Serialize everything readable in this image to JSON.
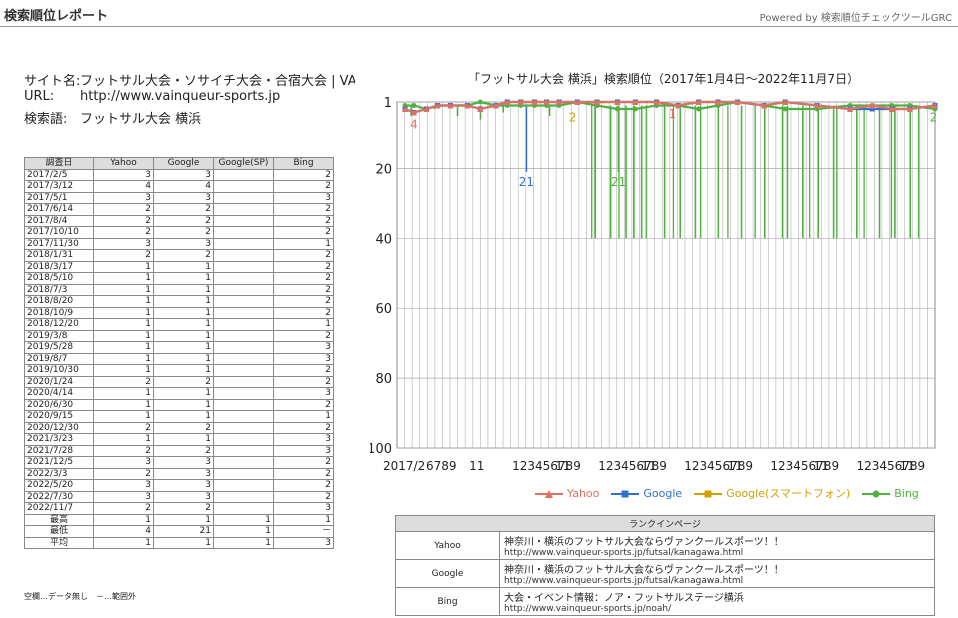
{
  "header": {
    "title": "検索順位レポート",
    "powered": "Powered by 検索順位チェックツールGRC"
  },
  "meta": {
    "site_label": "サイト名:",
    "site_value": "フットサル大会・ソサイチ大会・合宿大会 | VAINQUEUR",
    "url_label": "URL:",
    "url_value": "http://www.vainqueur-sports.jp",
    "keyword_label": "検索語:",
    "keyword_value": "フットサル大会 横浜"
  },
  "table": {
    "headers": [
      "調査日",
      "Yahoo",
      "Google",
      "Google(SP)",
      "Bing"
    ],
    "rows": [
      [
        "2017/2/5",
        "3",
        "3",
        "",
        "2"
      ],
      [
        "2017/3/12",
        "4",
        "4",
        "",
        "2"
      ],
      [
        "2017/5/1",
        "3",
        "3",
        "",
        "3"
      ],
      [
        "2017/6/14",
        "2",
        "2",
        "",
        "2"
      ],
      [
        "2017/8/4",
        "2",
        "2",
        "",
        "2"
      ],
      [
        "2017/10/10",
        "2",
        "2",
        "",
        "2"
      ],
      [
        "2017/11/30",
        "3",
        "3",
        "",
        "1"
      ],
      [
        "2018/1/31",
        "2",
        "2",
        "",
        "2"
      ],
      [
        "2018/3/17",
        "1",
        "1",
        "",
        "2"
      ],
      [
        "2018/5/10",
        "1",
        "1",
        "",
        "2"
      ],
      [
        "2018/7/3",
        "1",
        "1",
        "",
        "2"
      ],
      [
        "2018/8/20",
        "1",
        "1",
        "",
        "2"
      ],
      [
        "2018/10/9",
        "1",
        "1",
        "",
        "2"
      ],
      [
        "2018/12/20",
        "1",
        "1",
        "",
        "1"
      ],
      [
        "2019/3/8",
        "1",
        "1",
        "",
        "2"
      ],
      [
        "2019/5/28",
        "1",
        "1",
        "",
        "3"
      ],
      [
        "2019/8/7",
        "1",
        "1",
        "",
        "3"
      ],
      [
        "2019/10/30",
        "1",
        "1",
        "",
        "2"
      ],
      [
        "2020/1/24",
        "2",
        "2",
        "",
        "2"
      ],
      [
        "2020/4/14",
        "1",
        "1",
        "",
        "3"
      ],
      [
        "2020/6/30",
        "1",
        "1",
        "",
        "2"
      ],
      [
        "2020/9/15",
        "1",
        "1",
        "",
        "1"
      ],
      [
        "2020/12/30",
        "2",
        "2",
        "",
        "2"
      ],
      [
        "2021/3/23",
        "1",
        "1",
        "",
        "3"
      ],
      [
        "2021/7/28",
        "2",
        "2",
        "",
        "3"
      ],
      [
        "2021/12/5",
        "3",
        "3",
        "",
        "2"
      ],
      [
        "2022/3/3",
        "2",
        "3",
        "",
        "2"
      ],
      [
        "2022/5/20",
        "3",
        "3",
        "",
        "2"
      ],
      [
        "2022/7/30",
        "3",
        "3",
        "",
        "2"
      ],
      [
        "2022/11/7",
        "2",
        "2",
        "",
        "3"
      ]
    ],
    "stats": [
      [
        "最高",
        "1",
        "1",
        "1",
        "1"
      ],
      [
        "最低",
        "4",
        "21",
        "1",
        "－"
      ],
      [
        "平均",
        "1",
        "1",
        "1",
        "3"
      ]
    ]
  },
  "note": "空欄…データ無し　－…範囲外",
  "chart_data": {
    "type": "line",
    "title": "「フットサル大会 横浜」検索順位（2017年1月4日～2022年11月7日）",
    "y_inverted": true,
    "ylim": [
      1,
      100
    ],
    "y_ticks": [
      "1",
      "20",
      "40",
      "60",
      "80",
      "100"
    ],
    "x_tick_labels": [
      "2017/2",
      "6789",
      "11",
      "123456789",
      "11",
      "123456789",
      "11",
      "123456789",
      "11",
      "123456789",
      "11",
      "123456789",
      "11"
    ],
    "x_range": [
      "2017-01-04",
      "2022-11-07"
    ],
    "grid": true,
    "legend_position": "bottom",
    "series": [
      {
        "name": "Yahoo",
        "color": "#e07060",
        "marker": "triangle",
        "annotations": [
          {
            "label": "4",
            "date": "2017-03-12"
          },
          {
            "label": "1",
            "date": "2020-01-01"
          }
        ]
      },
      {
        "name": "Google",
        "color": "#3070d0",
        "marker": "square",
        "annotations": [
          {
            "label": "21",
            "date": "2018-06-01"
          }
        ]
      },
      {
        "name": "Google(スマートフォン)",
        "color": "#d0a000",
        "marker": "square",
        "annotations": [
          {
            "label": "2",
            "date": "2018-12-01"
          }
        ]
      },
      {
        "name": "Bing",
        "color": "#50b040",
        "marker": "circle",
        "annotations": [
          {
            "label": "21",
            "date": "2019-06-01"
          },
          {
            "label": "2",
            "date": "2022-11-01"
          }
        ]
      }
    ],
    "sampled_points": [
      {
        "date": "2017-02-05",
        "Yahoo": 3,
        "Google": 3,
        "Bing": 2
      },
      {
        "date": "2017-03-12",
        "Yahoo": 4,
        "Google": 4,
        "Bing": 2
      },
      {
        "date": "2017-05-01",
        "Yahoo": 3,
        "Google": 3,
        "Bing": 3
      },
      {
        "date": "2017-06-14",
        "Yahoo": 2,
        "Google": 2,
        "Bing": 2
      },
      {
        "date": "2017-08-04",
        "Yahoo": 2,
        "Google": 2,
        "Bing": 2
      },
      {
        "date": "2017-10-10",
        "Yahoo": 2,
        "Google": 2,
        "Bing": 2
      },
      {
        "date": "2017-11-30",
        "Yahoo": 3,
        "Google": 3,
        "Bing": 1
      },
      {
        "date": "2018-01-31",
        "Yahoo": 2,
        "Google": 2,
        "Bing": 2
      },
      {
        "date": "2018-03-17",
        "Yahoo": 1,
        "Google": 1,
        "Bing": 2
      },
      {
        "date": "2018-05-10",
        "Yahoo": 1,
        "Google": 1,
        "Bing": 2
      },
      {
        "date": "2018-07-03",
        "Yahoo": 1,
        "Google": 1,
        "Bing": 2
      },
      {
        "date": "2018-08-20",
        "Yahoo": 1,
        "Google": 1,
        "Bing": 2
      },
      {
        "date": "2018-10-09",
        "Yahoo": 1,
        "Google": 1,
        "Bing": 2
      },
      {
        "date": "2018-12-20",
        "Yahoo": 1,
        "Google": 1,
        "Bing": 1
      },
      {
        "date": "2019-03-08",
        "Yahoo": 1,
        "Google": 1,
        "Bing": 2
      },
      {
        "date": "2019-05-28",
        "Yahoo": 1,
        "Google": 1,
        "Bing": 3
      },
      {
        "date": "2019-08-07",
        "Yahoo": 1,
        "Google": 1,
        "Bing": 3
      },
      {
        "date": "2019-10-30",
        "Yahoo": 1,
        "Google": 1,
        "Bing": 2
      },
      {
        "date": "2020-01-24",
        "Yahoo": 2,
        "Google": 2,
        "Bing": 2
      },
      {
        "date": "2020-04-14",
        "Yahoo": 1,
        "Google": 1,
        "Bing": 3
      },
      {
        "date": "2020-06-30",
        "Yahoo": 1,
        "Google": 1,
        "Bing": 2
      },
      {
        "date": "2020-09-15",
        "Yahoo": 1,
        "Google": 1,
        "Bing": 1
      },
      {
        "date": "2020-12-30",
        "Yahoo": 2,
        "Google": 2,
        "Bing": 2
      },
      {
        "date": "2021-03-23",
        "Yahoo": 1,
        "Google": 1,
        "Bing": 3
      },
      {
        "date": "2021-07-28",
        "Yahoo": 2,
        "Google": 2,
        "Bing": 3
      },
      {
        "date": "2021-12-05",
        "Yahoo": 3,
        "Google": 3,
        "Bing": 2
      },
      {
        "date": "2022-03-03",
        "Yahoo": 2,
        "Google": 3,
        "Bing": 2
      },
      {
        "date": "2022-05-20",
        "Yahoo": 3,
        "Google": 3,
        "Bing": 2
      },
      {
        "date": "2022-07-30",
        "Yahoo": 3,
        "Google": 3,
        "Bing": 2
      },
      {
        "date": "2022-11-07",
        "Yahoo": 2,
        "Google": 2,
        "Bing": 3
      }
    ],
    "spikes": [
      {
        "series": "Google",
        "date": "2018-06-01",
        "value": 21
      },
      {
        "series": "Bing",
        "date": "2017-03-01",
        "value": 5
      },
      {
        "series": "Bing",
        "date": "2017-06-01",
        "value": 3
      },
      {
        "series": "Bing",
        "date": "2017-09-01",
        "value": 5
      },
      {
        "series": "Bing",
        "date": "2017-12-01",
        "value": 6
      },
      {
        "series": "Bing",
        "date": "2018-03-01",
        "value": 4
      },
      {
        "series": "Bing",
        "date": "2018-09-01",
        "value": 5
      },
      {
        "series": "Bing",
        "date": "2019-03-01",
        "value": 40
      },
      {
        "series": "Bing",
        "date": "2019-05-01",
        "value": 40
      },
      {
        "series": "Bing",
        "date": "2019-06-01",
        "value": 21
      },
      {
        "series": "Bing",
        "date": "2019-07-01",
        "value": 40
      },
      {
        "series": "Bing",
        "date": "2019-08-01",
        "value": 40
      },
      {
        "series": "Bing",
        "date": "2019-09-01",
        "value": 40
      },
      {
        "series": "Bing",
        "date": "2019-12-01",
        "value": 40
      },
      {
        "series": "Bing",
        "date": "2020-02-01",
        "value": 40
      },
      {
        "series": "Bing",
        "date": "2020-04-01",
        "value": 40
      },
      {
        "series": "Bing",
        "date": "2020-07-01",
        "value": 40
      },
      {
        "series": "Bing",
        "date": "2020-10-01",
        "value": 40
      },
      {
        "series": "Bing",
        "date": "2021-01-01",
        "value": 40
      },
      {
        "series": "Bing",
        "date": "2021-04-01",
        "value": 40
      },
      {
        "series": "Bing",
        "date": "2021-06-01",
        "value": 40
      },
      {
        "series": "Bing",
        "date": "2021-08-01",
        "value": 40
      },
      {
        "series": "Bing",
        "date": "2021-10-01",
        "value": 40
      },
      {
        "series": "Bing",
        "date": "2022-01-01",
        "value": 40
      },
      {
        "series": "Bing",
        "date": "2022-04-01",
        "value": 40
      },
      {
        "series": "Bing",
        "date": "2022-06-01",
        "value": 40
      },
      {
        "series": "Bing",
        "date": "2022-08-01",
        "value": 40
      }
    ]
  },
  "landing": {
    "header": "ランクインページ",
    "rows": [
      {
        "engine": "Yahoo",
        "title": "神奈川・横浜のフットサル大会ならヴァンクールスポーツ！！",
        "url": "http://www.vainqueur-sports.jp/futsal/kanagawa.html"
      },
      {
        "engine": "Google",
        "title": "神奈川・横浜のフットサル大会ならヴァンクールスポーツ！！",
        "url": "http://www.vainqueur-sports.jp/futsal/kanagawa.html"
      },
      {
        "engine": "Bing",
        "title": "大会・イベント情報：ノア・フットサルステージ横浜",
        "url": "http://www.vainqueur-sports.jp/noah/"
      }
    ]
  }
}
